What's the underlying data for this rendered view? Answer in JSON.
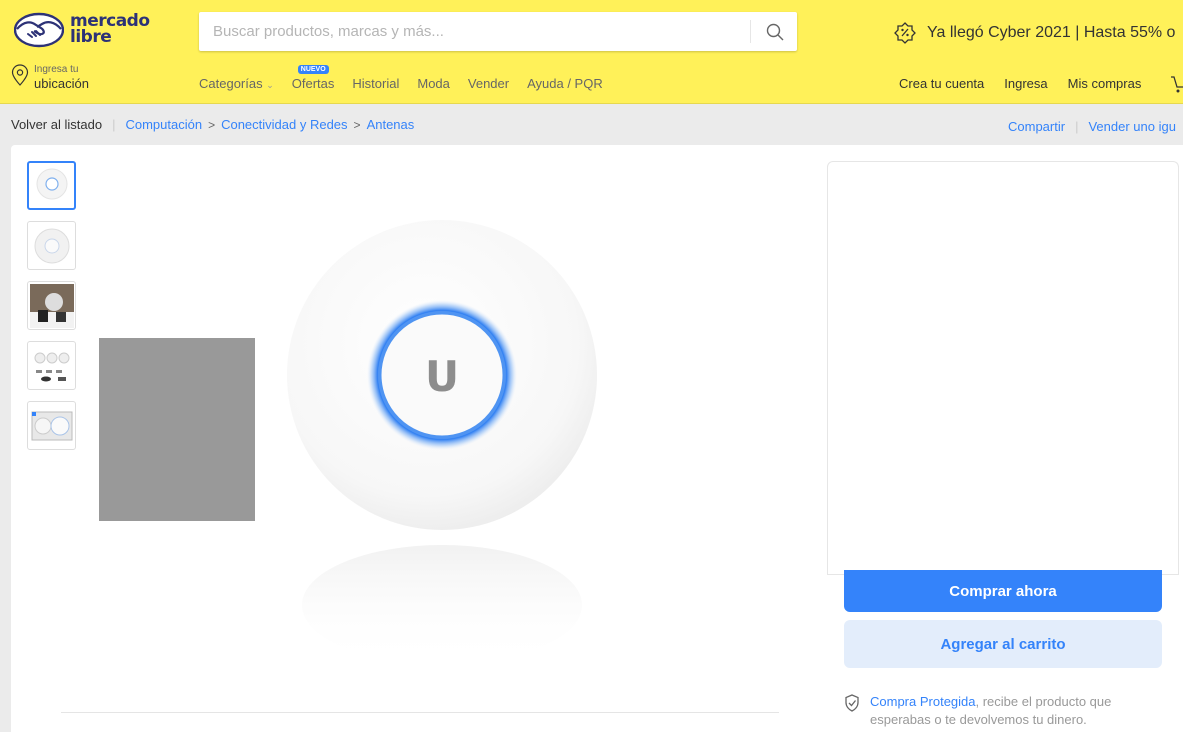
{
  "header": {
    "logo_text": "mercado\nlibre",
    "search_placeholder": "Buscar productos, marcas y más...",
    "promo_text": "Ya llegó Cyber 2021 | Hasta 55% o",
    "location": {
      "small": "Ingresa tu",
      "big": "ubicación"
    },
    "nav": [
      {
        "label": "Categorías"
      },
      {
        "label": "Ofertas",
        "badge": "NUEVO"
      },
      {
        "label": "Historial"
      },
      {
        "label": "Moda"
      },
      {
        "label": "Vender"
      },
      {
        "label": "Ayuda / PQR"
      }
    ],
    "account": [
      {
        "label": "Crea tu cuenta"
      },
      {
        "label": "Ingresa"
      },
      {
        "label": "Mis compras"
      }
    ]
  },
  "breadcrumb": {
    "back": "Volver al listado",
    "items": [
      "Computación",
      "Conectividad y Redes",
      "Antenas"
    ],
    "share": "Compartir",
    "sell": "Vender uno igu"
  },
  "product": {
    "logo_letter": "U",
    "thumbnail_count": 5
  },
  "buybox": {
    "buy_now": "Comprar ahora",
    "add_cart": "Agregar al carrito",
    "protect_link": "Compra Protegida",
    "protect_text": ", recibe el producto que esperabas o te devolvemos tu dinero."
  },
  "colors": {
    "brand_yellow": "#fff159",
    "accent_blue": "#3483fa",
    "light_blue": "#e3edfb"
  }
}
